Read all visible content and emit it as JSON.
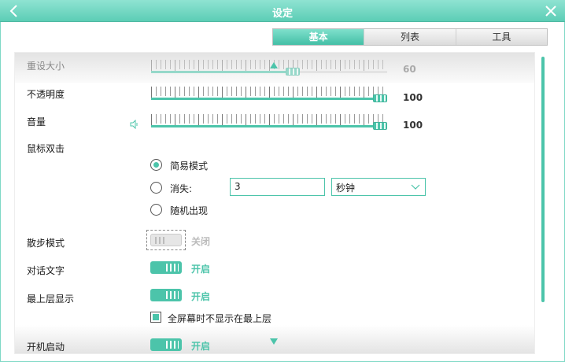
{
  "window": {
    "title": "设定"
  },
  "tabs": [
    {
      "label": "基本",
      "active": true
    },
    {
      "label": "列表",
      "active": false
    },
    {
      "label": "工具",
      "active": false
    }
  ],
  "settings": {
    "resize": {
      "label": "重设大小",
      "value": 60,
      "max": 100,
      "value_text": "60"
    },
    "opacity": {
      "label": "不透明度",
      "value": 100,
      "max": 100,
      "value_text": "100"
    },
    "volume": {
      "label": "音量",
      "value": 100,
      "max": 100,
      "value_text": "100"
    },
    "double_click": {
      "label": "鼠标双击",
      "options": {
        "simple": "简易模式",
        "disappear": "消失:",
        "random": "随机出现"
      },
      "selected": "simple",
      "disappear_value": "3",
      "disappear_unit": "秒钟"
    },
    "walk_mode": {
      "label": "散步模式",
      "state": "关闭"
    },
    "dialog_text": {
      "label": "对话文字",
      "state": "开启"
    },
    "always_on_top": {
      "label": "最上层显示",
      "state": "开启"
    },
    "fullscreen_hide": {
      "label": "全屏幕时不显示在最上层",
      "checked": true
    },
    "startup": {
      "label": "开机启动",
      "state": "开启"
    }
  },
  "colors": {
    "accent": "#4cc4aa",
    "title_bar": "#5ccdb5"
  }
}
